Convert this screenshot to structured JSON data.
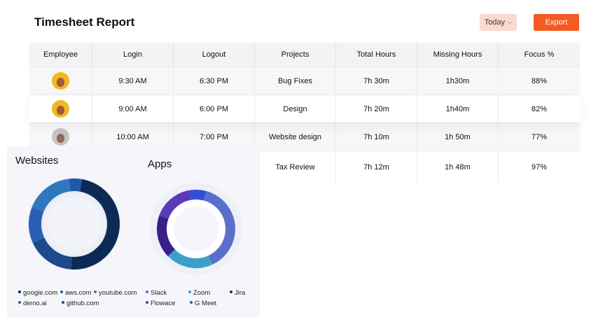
{
  "header": {
    "title": "Timesheet Report",
    "range_label": "Today",
    "export_label": "Export"
  },
  "table": {
    "columns": [
      "Employee",
      "Login",
      "Logout",
      "Projects",
      "Total Hours",
      "Missing Hours",
      "Focus %"
    ],
    "rows": [
      {
        "login": "9:30 AM",
        "logout": "6:30 PM",
        "project": "Bug Fixes",
        "total": "7h 30m",
        "missing": "1h30m",
        "focus": "88%"
      },
      {
        "login": "9:00 AM",
        "logout": "6:00 PM",
        "project": "Design",
        "total": "7h 20m",
        "missing": "1h40m",
        "focus": "82%"
      },
      {
        "login": "10:00 AM",
        "logout": "7:00 PM",
        "project": "Website design",
        "total": "7h 10m",
        "missing": "1h 50m",
        "focus": "77%"
      },
      {
        "login": "",
        "logout": "",
        "project": "Tax Review",
        "total": "7h 12m",
        "missing": "1h 48m",
        "focus": "97%"
      }
    ]
  },
  "websites": {
    "title": "Websites",
    "legend": [
      "google.com",
      "aws.com",
      "youtube.com",
      "demo.ai",
      "github.com"
    ],
    "colors": [
      "#0d2a55",
      "#1f5aa6",
      "#2f78c0",
      "#2c5fb3",
      "#1c4a8a"
    ]
  },
  "apps": {
    "title": "Apps",
    "legend": [
      "Slack",
      "Zoom",
      "Jira",
      "Flowace",
      "G Meet"
    ],
    "colors": [
      "#5a6fc9",
      "#3d9fc9",
      "#3a1e8a",
      "#5a3ab6",
      "#2e4fd6"
    ]
  }
}
